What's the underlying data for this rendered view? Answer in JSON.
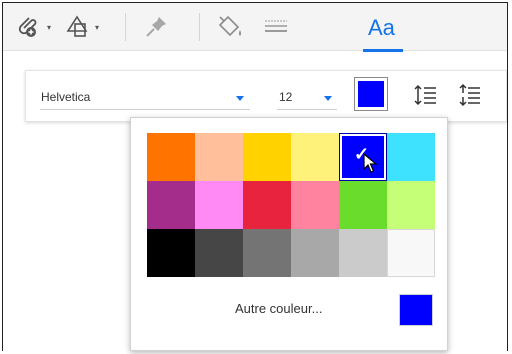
{
  "toolbar": {
    "tools": [
      {
        "name": "attach-tool",
        "icon": "paperclip-plus-icon"
      },
      {
        "name": "shape-tool",
        "icon": "shapes-icon"
      },
      {
        "name": "pin-tool",
        "icon": "pin-icon"
      },
      {
        "name": "fill-tool",
        "icon": "paint-bucket-icon"
      },
      {
        "name": "line-tool",
        "icon": "lines-icon"
      }
    ],
    "text_tool_label": "Aa",
    "accent": "#1473e6"
  },
  "properties": {
    "font_family": "Helvetica",
    "font_size": "12",
    "current_color": "#0000ff"
  },
  "palette": {
    "colors": [
      "#ff7300",
      "#ffbf9b",
      "#ffd200",
      "#fff27a",
      "#0000ff",
      "#3ee2ff",
      "#a42d8c",
      "#ff8af5",
      "#e8233d",
      "#ff839f",
      "#6adc2b",
      "#c5fe77",
      "#000000",
      "#464646",
      "#747474",
      "#a8a8a8",
      "#cbcbcb",
      "#f8f8f8"
    ],
    "selected_index": 4,
    "more_label": "Autre couleur...",
    "more_color": "#0000ff"
  }
}
